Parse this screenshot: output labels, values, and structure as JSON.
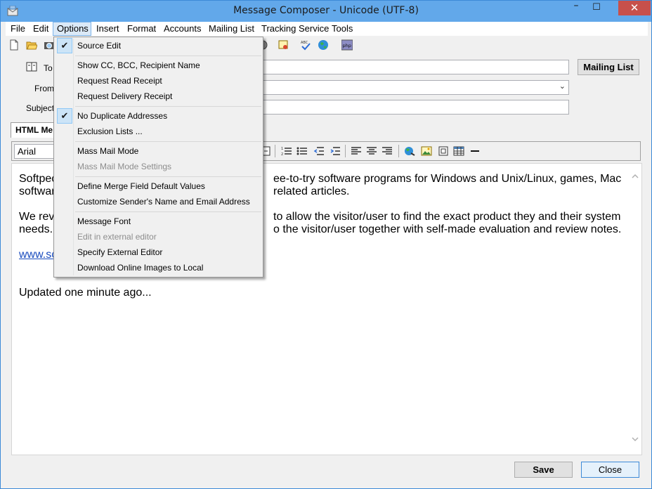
{
  "window": {
    "title": "Message Composer - Unicode (UTF-8)",
    "minimize_glyph": "–",
    "maximize_glyph": "☐",
    "close_glyph": "✕"
  },
  "menubar": {
    "items": [
      "File",
      "Edit",
      "Options",
      "Insert",
      "Format",
      "Accounts",
      "Mailing List",
      "Tracking Service",
      "Tools"
    ],
    "active": "Options"
  },
  "fields": {
    "to_label": "To",
    "from_label": "From",
    "subject_label": "Subject",
    "to_value": "",
    "from_value": "",
    "subject_value": "",
    "mailing_list_button": "Mailing List"
  },
  "editor_tab": {
    "label": "HTML Me"
  },
  "format_toolbar": {
    "font": "Arial"
  },
  "editor": {
    "line1_a": "Softpec",
    "line1_b": "ee-to-try software programs for Windows and Unix/Linux, games, Mac",
    "line2_a": "softwar",
    "line2_b": "related articles.",
    "line3_a": "We revi",
    "line3_b": "to allow the visitor/user to find the exact product they and their system",
    "line4_a": "needs.",
    "line4_b": "o the visitor/user together with self-made evaluation and review notes.",
    "link": "www.sc",
    "updated": "Updated one minute ago..."
  },
  "options_menu": {
    "items": [
      {
        "label": "Source Edit",
        "checked": true,
        "disabled": false
      },
      {
        "label": "Show CC, BCC, Recipient Name",
        "checked": false,
        "disabled": false
      },
      {
        "label": "Request Read Receipt",
        "checked": false,
        "disabled": false
      },
      {
        "label": "Request Delivery Receipt",
        "checked": false,
        "disabled": false
      },
      {
        "label": "No Duplicate Addresses",
        "checked": true,
        "disabled": false
      },
      {
        "label": "Exclusion Lists ...",
        "checked": false,
        "disabled": false
      },
      {
        "label": "Mass Mail Mode",
        "checked": false,
        "disabled": false
      },
      {
        "label": "Mass Mail Mode Settings",
        "checked": false,
        "disabled": true
      },
      {
        "label": "Define Merge Field Default Values",
        "checked": false,
        "disabled": false
      },
      {
        "label": "Customize Sender's Name and Email Address",
        "checked": false,
        "disabled": false
      },
      {
        "label": "Message Font",
        "checked": false,
        "disabled": false
      },
      {
        "label": "Edit in external editor",
        "checked": false,
        "disabled": true
      },
      {
        "label": "Specify External Editor",
        "checked": false,
        "disabled": false
      },
      {
        "label": "Download Online Images to Local",
        "checked": false,
        "disabled": false
      }
    ],
    "check_glyph": "✔"
  },
  "buttons": {
    "save": "Save",
    "close": "Close"
  },
  "colors": {
    "titlebar": "#62a8ea",
    "close_button": "#c7504b",
    "menu_highlight": "#cce4f7",
    "link": "#1a4cbe"
  }
}
